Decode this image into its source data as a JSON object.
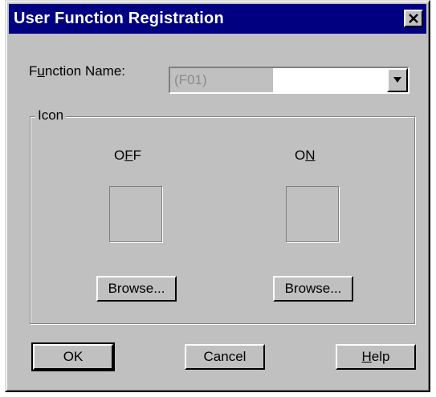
{
  "dialog": {
    "title": "User Function Registration"
  },
  "function_name": {
    "label_pre": "F",
    "label_mnemonic": "u",
    "label_post": "nction Name:",
    "value": "(F01)"
  },
  "icon_group": {
    "label": "Icon",
    "off": {
      "label_pre": "O",
      "label_mnemonic": "F",
      "label_post": "F",
      "browse_label": "Browse..."
    },
    "on": {
      "label_pre": "O",
      "label_mnemonic": "N",
      "label_post": "",
      "browse_label": "Browse..."
    }
  },
  "buttons": {
    "ok_label": "OK",
    "cancel_label": "Cancel",
    "help_mnemonic": "H",
    "help_post": "elp"
  },
  "icons": {
    "close": "close-icon",
    "dropdown": "chevron-down-icon"
  },
  "colors": {
    "titlebar": "#000080",
    "face": "#c0c0c0"
  }
}
